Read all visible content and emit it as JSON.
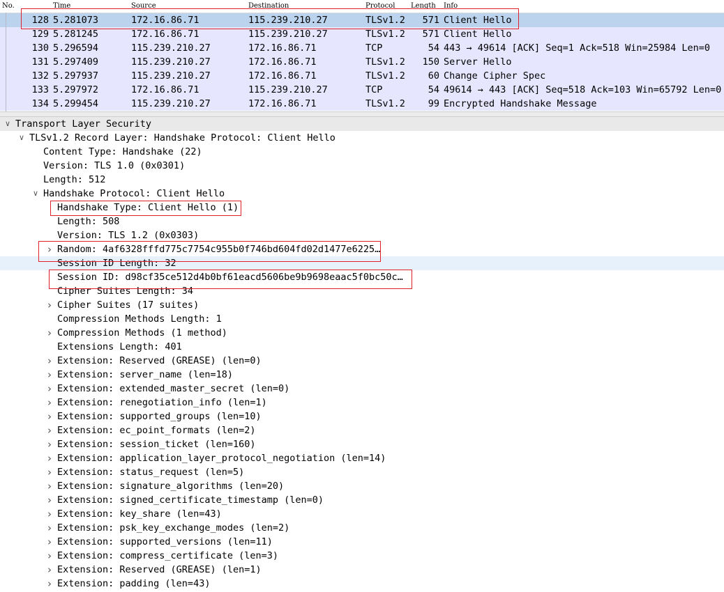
{
  "columns": {
    "no": "No.",
    "time": "Time",
    "source": "Source",
    "destination": "Destination",
    "protocol": "Protocol",
    "length": "Length",
    "info": "Info"
  },
  "packets": [
    {
      "no": "128",
      "time": "5.281073",
      "src": "172.16.86.71",
      "dst": "115.239.210.27",
      "proto": "TLSv1.2",
      "len": "571",
      "info": "Client Hello"
    },
    {
      "no": "129",
      "time": "5.281245",
      "src": "172.16.86.71",
      "dst": "115.239.210.27",
      "proto": "TLSv1.2",
      "len": "571",
      "info": "Client Hello"
    },
    {
      "no": "130",
      "time": "5.296594",
      "src": "115.239.210.27",
      "dst": "172.16.86.71",
      "proto": "TCP",
      "len": "54",
      "info": "443 → 49614 [ACK] Seq=1 Ack=518 Win=25984 Len=0"
    },
    {
      "no": "131",
      "time": "5.297409",
      "src": "115.239.210.27",
      "dst": "172.16.86.71",
      "proto": "TLSv1.2",
      "len": "150",
      "info": "Server Hello"
    },
    {
      "no": "132",
      "time": "5.297937",
      "src": "115.239.210.27",
      "dst": "172.16.86.71",
      "proto": "TLSv1.2",
      "len": "60",
      "info": "Change Cipher Spec"
    },
    {
      "no": "133",
      "time": "5.297972",
      "src": "172.16.86.71",
      "dst": "115.239.210.27",
      "proto": "TCP",
      "len": "54",
      "info": "49614 → 443 [ACK] Seq=518 Ack=103 Win=65792 Len=0"
    },
    {
      "no": "134",
      "time": "5.299454",
      "src": "115.239.210.27",
      "dst": "172.16.86.71",
      "proto": "TLSv1.2",
      "len": "99",
      "info": "Encrypted Handshake Message"
    }
  ],
  "tree": [
    {
      "text": "Transport Layer Security",
      "expander": "expanded"
    },
    {
      "text": "TLSv1.2 Record Layer: Handshake Protocol: Client Hello",
      "expander": "expanded"
    },
    {
      "text": "Content Type: Handshake (22)",
      "expander": "none"
    },
    {
      "text": "Version: TLS 1.0 (0x0301)",
      "expander": "none"
    },
    {
      "text": "Length: 512",
      "expander": "none"
    },
    {
      "text": "Handshake Protocol: Client Hello",
      "expander": "expanded"
    },
    {
      "text": "Handshake Type: Client Hello (1)",
      "expander": "none"
    },
    {
      "text": "Length: 508",
      "expander": "none"
    },
    {
      "text": "Version: TLS 1.2 (0x0303)",
      "expander": "none"
    },
    {
      "text": "Random: 4af6328fffd775c7754c955b0f746bd604fd02d1477e6225…",
      "expander": "collapsed"
    },
    {
      "text": "Session ID Length: 32",
      "expander": "none"
    },
    {
      "text": "Session ID: d98cf35ce512d4b0bf61eacd5606be9b9698eaac5f0bc50c…",
      "expander": "none"
    },
    {
      "text": "Cipher Suites Length: 34",
      "expander": "none"
    },
    {
      "text": "Cipher Suites (17 suites)",
      "expander": "collapsed"
    },
    {
      "text": "Compression Methods Length: 1",
      "expander": "none"
    },
    {
      "text": "Compression Methods (1 method)",
      "expander": "collapsed"
    },
    {
      "text": "Extensions Length: 401",
      "expander": "none"
    },
    {
      "text": "Extension: Reserved (GREASE) (len=0)",
      "expander": "collapsed"
    },
    {
      "text": "Extension: server_name (len=18)",
      "expander": "collapsed"
    },
    {
      "text": "Extension: extended_master_secret (len=0)",
      "expander": "collapsed"
    },
    {
      "text": "Extension: renegotiation_info (len=1)",
      "expander": "collapsed"
    },
    {
      "text": "Extension: supported_groups (len=10)",
      "expander": "collapsed"
    },
    {
      "text": "Extension: ec_point_formats (len=2)",
      "expander": "collapsed"
    },
    {
      "text": "Extension: session_ticket (len=160)",
      "expander": "collapsed"
    },
    {
      "text": "Extension: application_layer_protocol_negotiation (len=14)",
      "expander": "collapsed"
    },
    {
      "text": "Extension: status_request (len=5)",
      "expander": "collapsed"
    },
    {
      "text": "Extension: signature_algorithms (len=20)",
      "expander": "collapsed"
    },
    {
      "text": "Extension: signed_certificate_timestamp (len=0)",
      "expander": "collapsed"
    },
    {
      "text": "Extension: key_share (len=43)",
      "expander": "collapsed"
    },
    {
      "text": "Extension: psk_key_exchange_modes (len=2)",
      "expander": "collapsed"
    },
    {
      "text": "Extension: supported_versions (len=11)",
      "expander": "collapsed"
    },
    {
      "text": "Extension: compress_certificate (len=3)",
      "expander": "collapsed"
    },
    {
      "text": "Extension: Reserved (GREASE) (len=1)",
      "expander": "collapsed"
    },
    {
      "text": "Extension: padding (len=43)",
      "expander": "collapsed"
    }
  ],
  "icons": {
    "expanded": "chevron-down-icon",
    "collapsed": "chevron-right-icon"
  },
  "colors": {
    "row_bg": "#e7e6ff",
    "selected_row_bg": "#bcd3ee",
    "annotation": "#e0202a"
  }
}
